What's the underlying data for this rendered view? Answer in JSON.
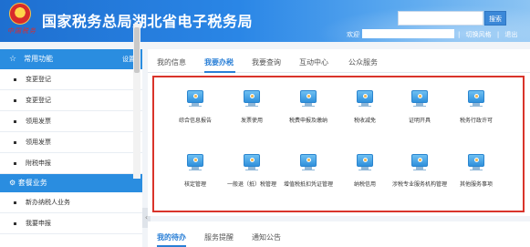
{
  "header": {
    "site_title": "国家税务总局湖北省电子税务局",
    "emblem_text": "中国税务",
    "search_placeholder": "",
    "search_button": "搜索",
    "login_label": "欢迎",
    "links": [
      "|",
      "切换风格",
      "|",
      "退出"
    ]
  },
  "sidebar": {
    "section1_title": "常用功能",
    "section1_settings": "设置",
    "items": [
      "变更登记",
      "变更登记",
      "领用发票",
      "领用发票",
      "附税申报"
    ],
    "section2_title": "套餐业务",
    "items2": [
      "新办纳税人业务",
      "我要申报"
    ]
  },
  "main": {
    "tabs": [
      "我的信息",
      "我要办税",
      "我要查询",
      "互动中心",
      "公众服务"
    ],
    "active_tab": "我要办税",
    "services_row1": [
      "综合信息报告",
      "发票使用",
      "税费申报及缴纳",
      "税收减免",
      "证明开具",
      "税务行政许可"
    ],
    "services_row2": [
      "核定管理",
      "一般退（抵）税管理",
      "增值税抵扣凭证管理",
      "纳税信用",
      "涉税专业服务机构管理",
      "其他服务事项"
    ]
  },
  "bottom": {
    "tabs": [
      "我的待办",
      "服务提醒",
      "通知公告"
    ],
    "active_tab": "我的待办"
  },
  "colors": {
    "brand_blue": "#2a8de0",
    "highlight_red": "#d9342b",
    "active_tab": "#2a7fd6"
  }
}
